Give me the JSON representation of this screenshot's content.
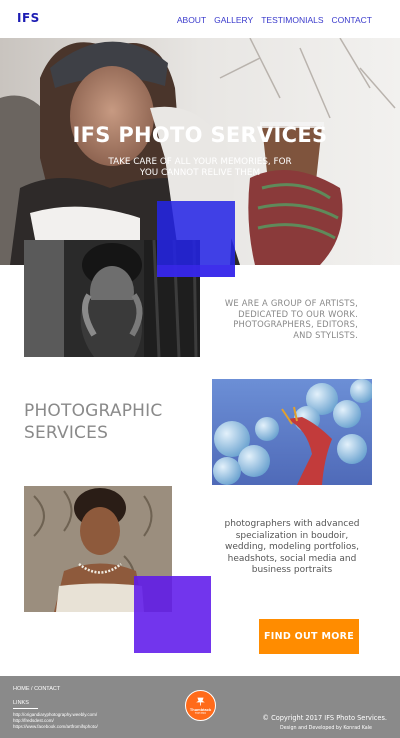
{
  "header": {
    "logo": "IFS",
    "nav": [
      "ABOUT",
      "GALLERY",
      "TESTIMONIALS",
      "CONTACT"
    ]
  },
  "hero": {
    "title": "IFS PHOTO SERVICES",
    "subtitle": "TAKE CARE OF ALL YOUR MEMORIES, FOR YOU CANNOT RELIVE THEM"
  },
  "about": {
    "text": "WE ARE A GROUP OF ARTISTS, DEDICATED TO OUR WORK. PHOTOGRAPHERS, EDITORS, AND STYLISTS."
  },
  "services": {
    "title": "PHOTOGRAPHIC SERVICES",
    "text": "photographers with advanced specialization in boudoir, wedding, modeling portfolios, headshots, social media and business portraits",
    "cta": "FIND OUT MORE"
  },
  "footer": {
    "home_contact": "HOME / CONTACT",
    "links_label": "LINKS",
    "links": [
      "http://origandiaryphotography.weebly.com/",
      "http://fredsdest.com/",
      "https://www.facebook.com/artfromifsphoto/"
    ],
    "badge_label": "Thumbtack",
    "badge_sub": "TOP PRO",
    "copyright": "© Copyright 2017 IFS Photo Services.",
    "designed_by": "Design and Developed by Konrad Kale"
  },
  "colors": {
    "accent_blue": "#2424e6",
    "accent_purple": "#5f19eb",
    "cta_orange": "#ff8c00",
    "footer_gray": "#8a8a8a"
  }
}
